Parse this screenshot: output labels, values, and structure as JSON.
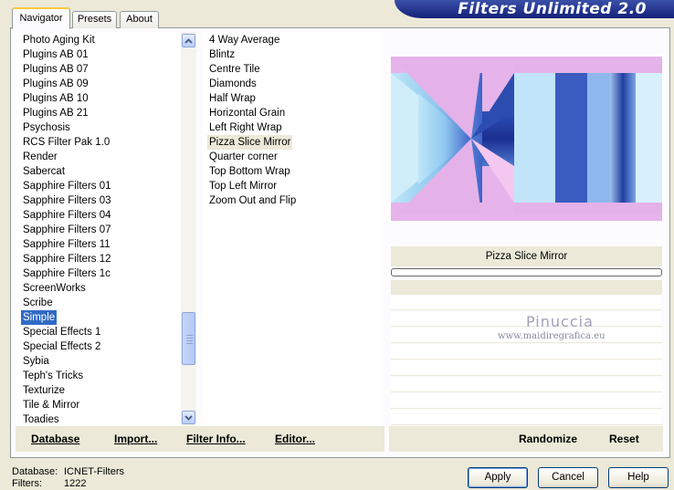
{
  "app": {
    "title": "Filters Unlimited 2.0"
  },
  "tabs": [
    {
      "label": "Navigator",
      "active": true
    },
    {
      "label": "Presets",
      "active": false
    },
    {
      "label": "About",
      "active": false
    }
  ],
  "categories": {
    "items": [
      "Photo Aging Kit",
      "Plugins AB 01",
      "Plugins AB 07",
      "Plugins AB 09",
      "Plugins AB 10",
      "Plugins AB 21",
      "Psychosis",
      "RCS Filter Pak 1.0",
      "Render",
      "Sabercat",
      "Sapphire Filters 01",
      "Sapphire Filters 03",
      "Sapphire Filters 04",
      "Sapphire Filters 07",
      "Sapphire Filters 11",
      "Sapphire Filters 12",
      "Sapphire Filters 1c",
      "ScreenWorks",
      "Scribe",
      "Simple",
      "Special Effects 1",
      "Special Effects 2",
      "Sybia",
      "Teph's Tricks",
      "Texturize",
      "Tile & Mirror",
      "Toadies"
    ],
    "selected": "Simple"
  },
  "filters": {
    "items": [
      "4 Way Average",
      "Blintz",
      "Centre Tile",
      "Diamonds",
      "Half Wrap",
      "Horizontal Grain",
      "Left Right Wrap",
      "Pizza Slice Mirror",
      "Quarter corner",
      "Top Bottom Wrap",
      "Top Left Mirror",
      "Zoom Out and Flip"
    ],
    "selected": "Pizza Slice Mirror"
  },
  "preview": {
    "filter_name": "Pizza Slice Mirror",
    "watermark_name": "Pinuccia",
    "watermark_url": "www.maidiregrafica.eu"
  },
  "toolbar": {
    "database": "Database",
    "import": "Import...",
    "filter_info": "Filter Info...",
    "editor": "Editor...",
    "randomize": "Randomize",
    "reset": "Reset"
  },
  "footer": {
    "database_label": "Database:",
    "database_value": "ICNET-Filters",
    "filters_label": "Filters:",
    "filters_value": "1222"
  },
  "buttons": {
    "apply": "Apply",
    "cancel": "Cancel",
    "help": "Help"
  },
  "colors": {
    "banner": "#13217a",
    "selection": "#316ac5",
    "tab_accent": "#ffc83c"
  }
}
